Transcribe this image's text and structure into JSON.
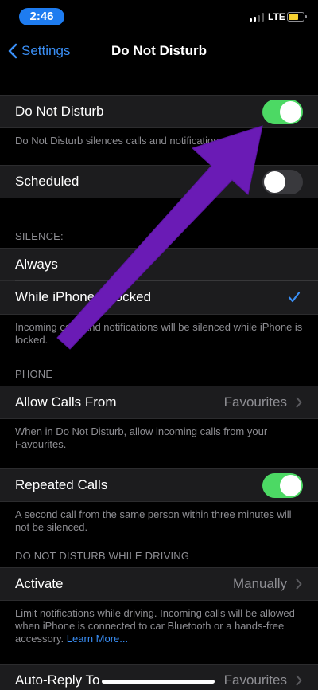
{
  "status_bar": {
    "time": "2:46",
    "network": "LTE"
  },
  "nav": {
    "back_label": "Settings",
    "title": "Do Not Disturb"
  },
  "rows": {
    "dnd": {
      "label": "Do Not Disturb",
      "enabled": true
    },
    "dnd_footer": "Do Not Disturb silences calls and notifications",
    "scheduled": {
      "label": "Scheduled",
      "enabled": false
    },
    "silence_header": "SILENCE:",
    "always": {
      "label": "Always"
    },
    "locked": {
      "label": "While iPhone is locked",
      "selected": true
    },
    "silence_footer": "Incoming calls and notifications will be silenced while iPhone is locked.",
    "phone_header": "PHONE",
    "allow_calls": {
      "label": "Allow Calls From",
      "value": "Favourites"
    },
    "allow_footer": "When in Do Not Disturb, allow incoming calls from your Favourites.",
    "repeated": {
      "label": "Repeated Calls",
      "enabled": true
    },
    "repeated_footer": "A second call from the same person within three minutes will not be silenced.",
    "driving_header": "DO NOT DISTURB WHILE DRIVING",
    "activate": {
      "label": "Activate",
      "value": "Manually"
    },
    "activate_footer": "Limit notifications while driving. Incoming calls will be allowed when iPhone is connected to car Bluetooth or a hands-free accessory.",
    "learn_more": "Learn More...",
    "auto_reply": {
      "label": "Auto-Reply To",
      "value": "Favourites"
    }
  },
  "colors": {
    "accent": "#3a8ff6",
    "toggle_on": "#4cd964",
    "annotation_arrow": "#6a1bb5",
    "time_pill": "#1e7cf0",
    "battery": "#f7d131"
  }
}
